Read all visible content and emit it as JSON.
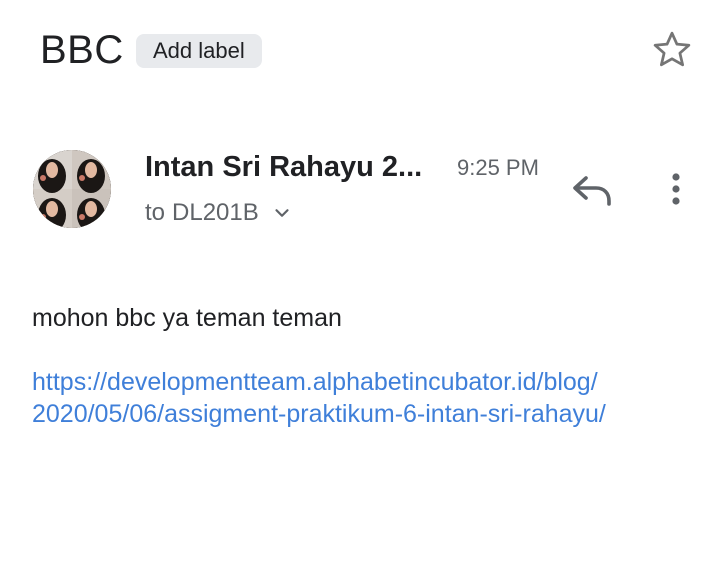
{
  "header": {
    "subject": "BBC",
    "label_chip": "Add label",
    "star_icon": "star-outline-icon"
  },
  "message": {
    "sender_name": "Intan Sri Rahayu 2...",
    "time": "9:25 PM",
    "recipient_prefix": "to",
    "recipient": "DL201B",
    "expand_icon": "chevron-down-icon",
    "reply_icon": "reply-icon",
    "more_icon": "more-vertical-icon",
    "avatar": "sender-avatar-photo-grid",
    "body_text": "mohon bbc ya teman teman",
    "link_line1": "https://developmentteam.alphabetincubator.id/blog/",
    "link_line2": "2020/05/06/assigment-praktikum-6-intan-sri-rahayu/"
  },
  "colors": {
    "text_primary": "#202124",
    "text_secondary": "#5f6368",
    "link": "#3f7fd9",
    "chip_bg": "#e8eaed"
  }
}
